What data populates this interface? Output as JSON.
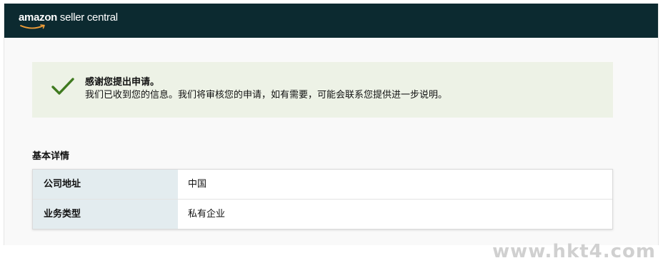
{
  "header": {
    "logo_brand": "amazon",
    "logo_rest": " seller central"
  },
  "success_banner": {
    "icon": "checkmark-icon",
    "title": "感谢您提出申请。",
    "message": "我们已收到您的信息。我们将审核您的申请，如有需要，可能会联系您提供进一步说明。"
  },
  "details": {
    "section_title": "基本详情",
    "rows": [
      {
        "label": "公司地址",
        "value": "中国"
      },
      {
        "label": "业务类型",
        "value": "私有企业"
      }
    ]
  },
  "watermark": "www.hkt4.com",
  "colors": {
    "header_bg": "#0c2a30",
    "success_bg": "#edf2e6",
    "check_color": "#3f7a1f",
    "label_bg": "#e3ecef",
    "smile_color": "#f19e38"
  }
}
